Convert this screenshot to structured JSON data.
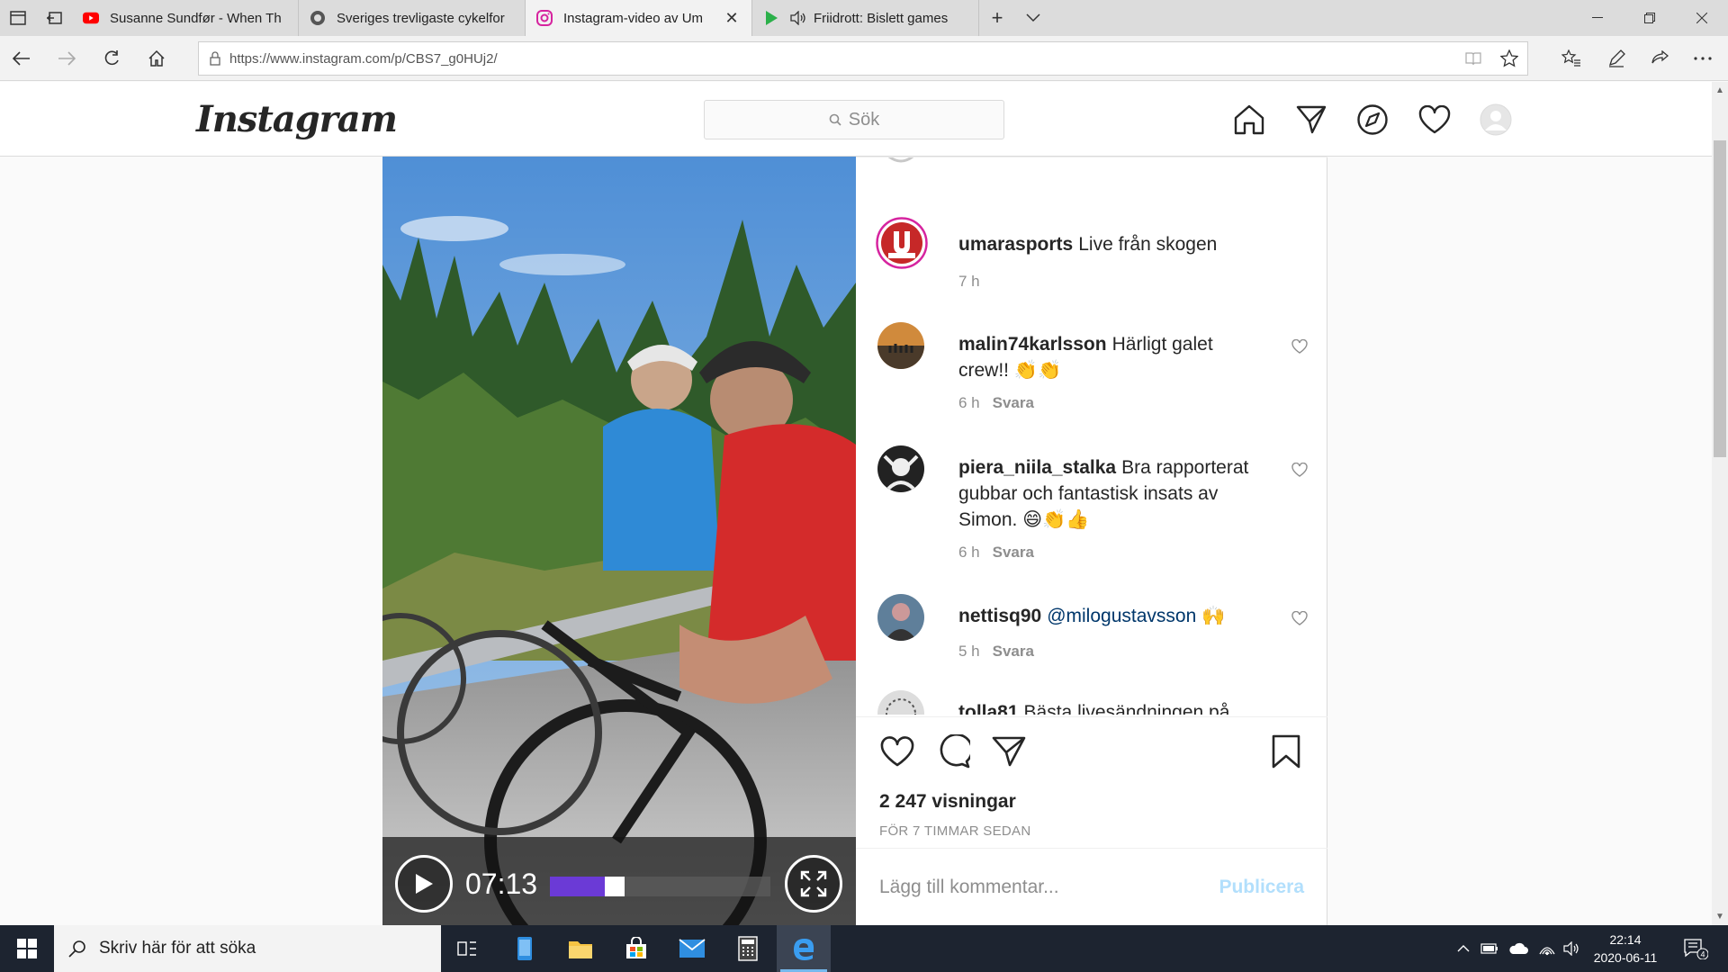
{
  "browser": {
    "tabs": [
      {
        "title": "Susanne Sundfør - When Th",
        "icon": "youtube-icon",
        "active": false
      },
      {
        "title": "Sveriges trevligaste cykelfor",
        "icon": "site-icon",
        "active": false
      },
      {
        "title": "Instagram-video av Um",
        "icon": "instagram-icon",
        "active": true
      },
      {
        "title": "Friidrott: Bislett games",
        "icon": "play-icon",
        "active": false
      }
    ],
    "url": "https://www.instagram.com/p/CBS7_g0HUj2/"
  },
  "instagram": {
    "logo": "Instagram",
    "search_placeholder": "Sök"
  },
  "post": {
    "caption": {
      "user": "umarasports",
      "text": "Live från skogen",
      "time": "7 h"
    },
    "comments": [
      {
        "user": "malin74karlsson",
        "text": "Härligt galet crew!! 👏👏",
        "time": "6 h",
        "reply": "Svara"
      },
      {
        "user": "piera_niila_stalka",
        "text": "Bra rapporterat gubbar och fantastisk insats av Simon. 😄👏👍",
        "time": "6 h",
        "reply": "Svara"
      },
      {
        "user": "nettisq90",
        "mention": "@milogustavsson",
        "text": "🙌",
        "time": "5 h",
        "reply": "Svara"
      },
      {
        "user": "tolla81",
        "text": "Bästa livesändningen på"
      }
    ],
    "views": "2 247 visningar",
    "time_ago": "FÖR 7 TIMMAR SEDAN",
    "add_comment_placeholder": "Lägg till kommentar...",
    "publish_label": "Publicera"
  },
  "video": {
    "time": "07:13",
    "progress": 0.25
  },
  "taskbar": {
    "search_placeholder": "Skriv här för att söka",
    "time": "22:14",
    "date": "2020-06-11",
    "notifications": "4"
  },
  "colors": {
    "ig_text": "#262626",
    "ig_muted": "#8e8e8e",
    "publish_disabled": "#b2dffc",
    "video_progress": "#6b3ad6",
    "taskbar": "#1d2430"
  }
}
